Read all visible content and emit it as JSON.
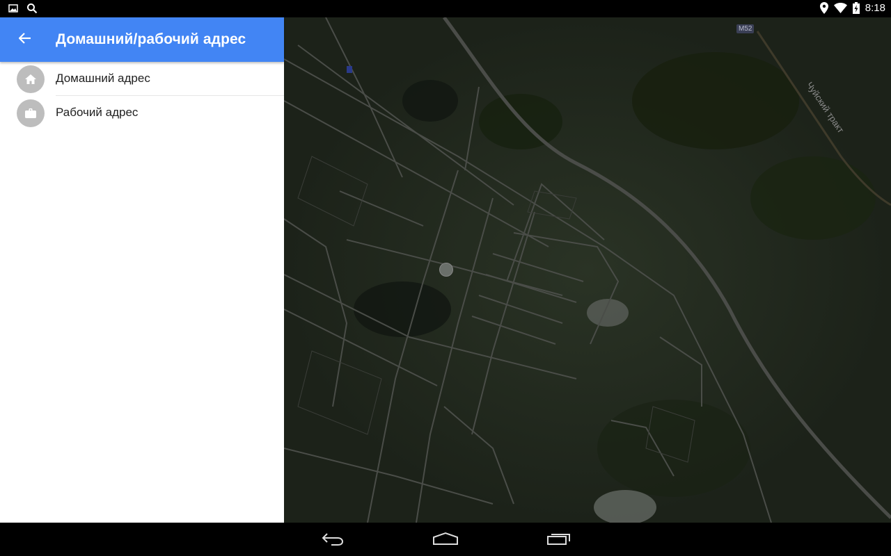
{
  "status_bar": {
    "time": "8:18",
    "left_icons": [
      "image-icon",
      "search-icon"
    ],
    "right_icons": [
      "location-pin-icon",
      "wifi-icon",
      "battery-charging-icon"
    ]
  },
  "panel": {
    "title": "Домашний/рабочий адрес",
    "items": [
      {
        "label": "Домашний адрес",
        "icon": "home-icon"
      },
      {
        "label": "Рабочий адрес",
        "icon": "briefcase-icon"
      }
    ]
  },
  "map": {
    "road_label": "Чуйский тракт",
    "route_shield": "M52"
  },
  "navbar": {
    "buttons": [
      "back-icon",
      "home-icon",
      "recents-icon"
    ]
  },
  "colors": {
    "accent": "#4285f4",
    "avatar_bg": "#bdbdbd",
    "map_bg": "#1c2219"
  }
}
